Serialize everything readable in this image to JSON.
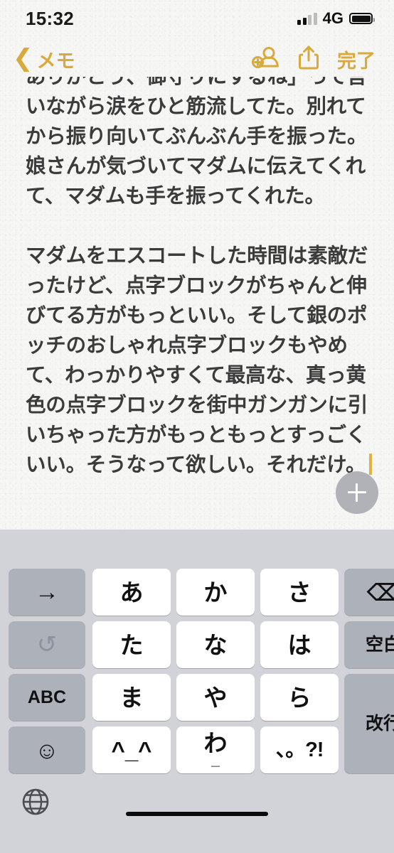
{
  "status_bar": {
    "time": "15:32",
    "network": "4G",
    "signal_bars_filled": 2,
    "signal_bars_total": 4,
    "battery_full": true
  },
  "nav_bar": {
    "back_chevron": "chevron-left-icon",
    "back_label": "メモ",
    "add_person_icon": "add-person-icon",
    "share_icon": "share-icon",
    "done_label": "完了",
    "accent_color": "#d8a93c"
  },
  "note": {
    "text_color": "#3b3b3b",
    "background_color": "#f6f6f5",
    "caret_color": "#e0b33e",
    "paragraphs": [
      {
        "id": "p1",
        "clipped_top": true,
        "text": "ありがとう、御守りにするね」って言いながら涙をひと筋流してた。別れてから振り向いてぶんぶん手を振った。娘さんが気づいてマダムに伝えてくれて、マダムも手を振ってくれた。"
      },
      {
        "id": "p2",
        "clipped_top": false,
        "text": "マダムをエスコートした時間は素敵だったけど、点字ブロックがちゃんと伸びてる方がもっといい。そして銀のポッチのおしゃれ点字ブロックもやめて、わっかりやすくて最高な、真っ黄色の点字ブロックを街中ガンガンに引いちゃった方がもっともっとすっごくいい。そうなって欲しい。それだけ。"
      }
    ]
  },
  "fab": {
    "icon": "plus-icon",
    "label": "",
    "color": "#b0b2b8"
  },
  "keyboard": {
    "background_color": "#d1d3d8",
    "light_key_color": "#ffffff",
    "dark_key_color": "#adb1ba",
    "suggestion_bar_text": "",
    "keys": [
      {
        "id": "k-arrow",
        "glyph": "→",
        "name": "cursor-right-key",
        "style": "dark",
        "size": "arrow"
      },
      {
        "id": "k-a",
        "glyph": "あ",
        "name": "kana-key-a",
        "style": "light",
        "size": "normal"
      },
      {
        "id": "k-ka",
        "glyph": "か",
        "name": "kana-key-ka",
        "style": "light",
        "size": "normal"
      },
      {
        "id": "k-sa",
        "glyph": "さ",
        "name": "kana-key-sa",
        "style": "light",
        "size": "normal"
      },
      {
        "id": "k-del",
        "glyph": "⌫",
        "name": "delete-key",
        "style": "dark",
        "size": "icon"
      },
      {
        "id": "k-undo",
        "glyph": "↺",
        "name": "undo-key",
        "style": "dark",
        "size": "dim"
      },
      {
        "id": "k-ta",
        "glyph": "た",
        "name": "kana-key-ta",
        "style": "light",
        "size": "normal"
      },
      {
        "id": "k-na",
        "glyph": "な",
        "name": "kana-key-na",
        "style": "light",
        "size": "normal"
      },
      {
        "id": "k-ha",
        "glyph": "は",
        "name": "kana-key-ha",
        "style": "light",
        "size": "normal"
      },
      {
        "id": "k-space",
        "glyph": "空白",
        "name": "space-key",
        "style": "dark",
        "size": "small"
      },
      {
        "id": "k-abc",
        "glyph": "ABC",
        "name": "abc-mode-key",
        "style": "dark",
        "size": "small"
      },
      {
        "id": "k-ma",
        "glyph": "ま",
        "name": "kana-key-ma",
        "style": "light",
        "size": "normal"
      },
      {
        "id": "k-ya",
        "glyph": "や",
        "name": "kana-key-ya",
        "style": "light",
        "size": "normal"
      },
      {
        "id": "k-ra",
        "glyph": "ら",
        "name": "kana-key-ra",
        "style": "light",
        "size": "normal"
      },
      {
        "id": "k-return",
        "glyph": "改行",
        "name": "return-key",
        "style": "dark",
        "size": "small"
      },
      {
        "id": "k-emoji",
        "glyph": "☺",
        "name": "emoji-key",
        "style": "dark",
        "size": "icon"
      },
      {
        "id": "k-kao",
        "glyph": "^_^",
        "name": "kaomoji-key",
        "style": "light",
        "size": "normal"
      },
      {
        "id": "k-wa",
        "glyph": "わ",
        "name": "kana-key-wa",
        "style": "light",
        "size": "sub",
        "sub": "_"
      },
      {
        "id": "k-punct",
        "glyph": "、。?!",
        "name": "punctuation-key",
        "style": "light",
        "size": "punct"
      }
    ],
    "globe_key": "globe-icon",
    "home_indicator": "home-indicator"
  }
}
